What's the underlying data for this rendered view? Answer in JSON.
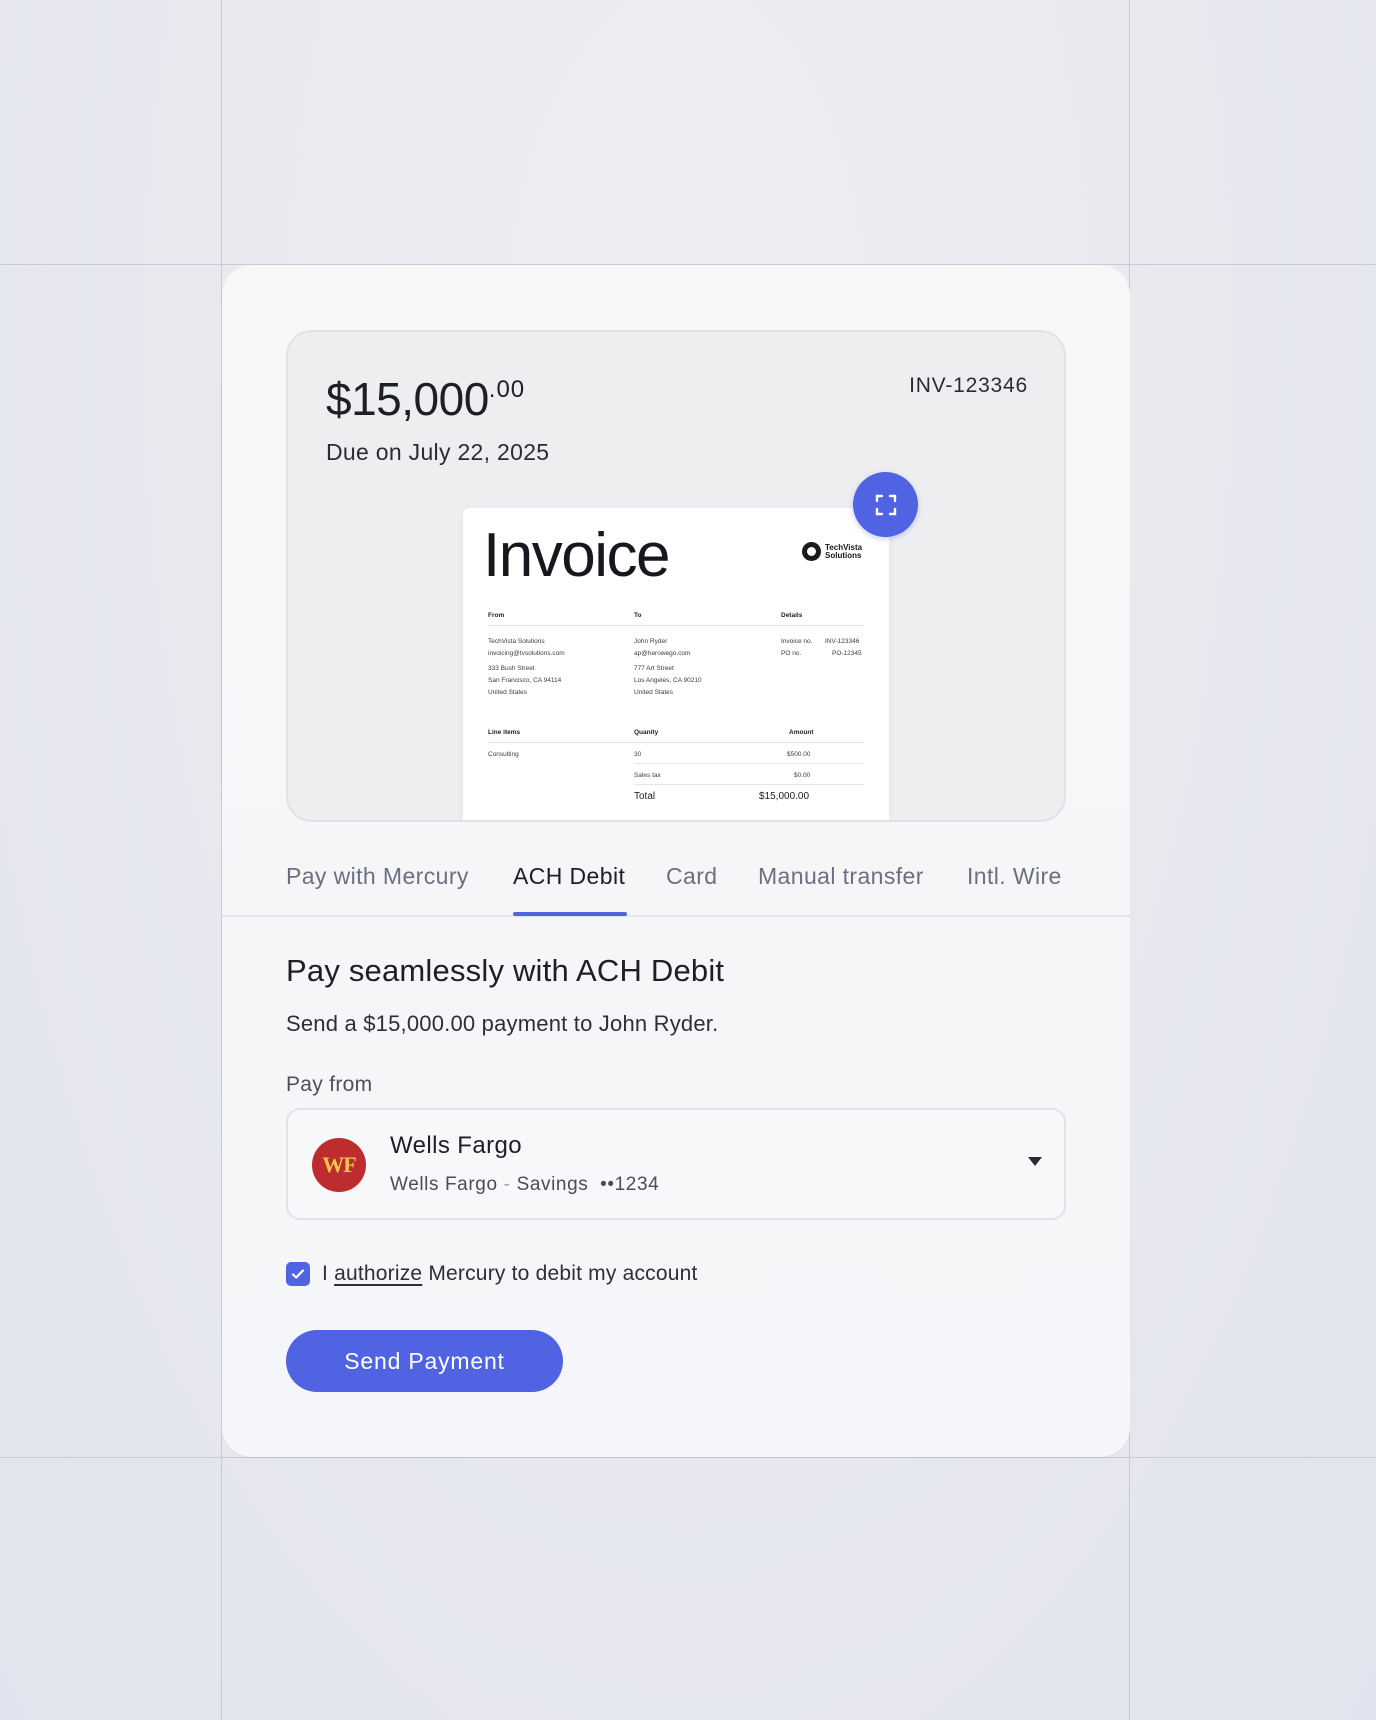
{
  "invoice": {
    "amount_main": "$15,000",
    "amount_cents": ".00",
    "due": "Due on July 22, 2025",
    "number": "INV-123346"
  },
  "document": {
    "title": "Invoice",
    "logo_name_line1": "TechVista",
    "logo_name_line2": "Solutions",
    "from_header": "From",
    "to_header": "To",
    "details_header": "Details",
    "from_lines": [
      "TechVista Solutions",
      "invoicing@tvsolutions.com",
      "333 Bush Street",
      "San Francisco, CA 94114",
      "United States"
    ],
    "to_lines": [
      "John Ryder",
      "ap@herowego.com",
      "777 Art Street",
      "Los Angeles, CA 90210",
      "United States"
    ],
    "details": [
      {
        "label": "Invoice no.",
        "value": "INV-123346"
      },
      {
        "label": "PO no.",
        "value": "PO-12345"
      }
    ],
    "line_items_header": "Line items",
    "quantity_header": "Quanity",
    "amount_header": "Amount",
    "line_item": {
      "name": "Consulting",
      "qty": "30",
      "amount": "$500.00"
    },
    "sales_tax_label": "Sales tax",
    "sales_tax_value": "$0.00",
    "total_label": "Total",
    "total_value": "$15,000.00"
  },
  "tabs": [
    {
      "label": "Pay with Mercury",
      "active": false
    },
    {
      "label": "ACH Debit",
      "active": true
    },
    {
      "label": "Card",
      "active": false
    },
    {
      "label": "Manual transfer",
      "active": false
    },
    {
      "label": "Intl. Wire",
      "active": false
    }
  ],
  "ach": {
    "heading": "Pay seamlessly with ACH Debit",
    "subtitle": "Send a $15,000.00 payment to John Ryder.",
    "pay_from_label": "Pay from"
  },
  "account": {
    "logo_text": "WF",
    "name": "Wells Fargo",
    "bank": "Wells Fargo",
    "separator": "-",
    "type": "Savings",
    "mask": "••1234"
  },
  "consent": {
    "prefix": "I",
    "link": "authorize",
    "suffix": "Mercury to debit my account",
    "checked": true
  },
  "send_button": "Send Payment",
  "icons": {
    "expand": "expand-icon",
    "caret": "chevron-down-icon",
    "check": "check-icon"
  },
  "colors": {
    "accent": "#4f63e3",
    "bank_logo_bg": "#bd2c2e",
    "bank_logo_text": "#f3c64a"
  }
}
